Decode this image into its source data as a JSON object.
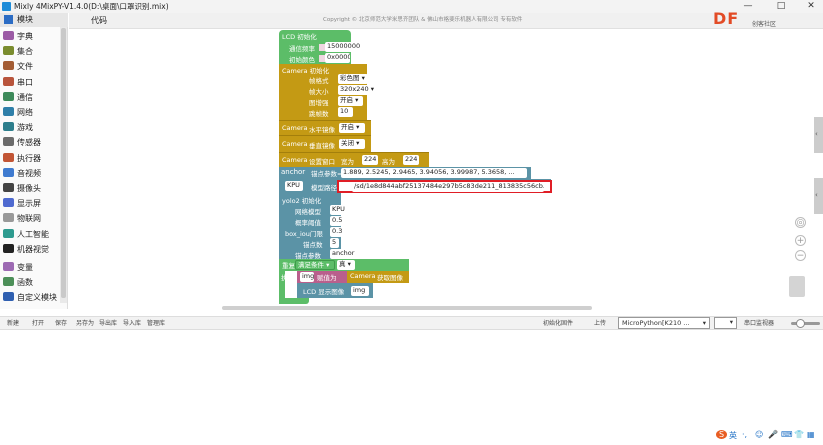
{
  "window": {
    "title": "Mixly 4MixPY-V1.4.0(D:\\桌面\\口罩识别.mix)",
    "controls": {
      "minimize": "—",
      "maximize": "□",
      "close": "✕"
    }
  },
  "sidebar": {
    "header": "模块",
    "items": [
      {
        "label": "字典",
        "color": "#9b5ba5"
      },
      {
        "label": "集合",
        "color": "#7a8c2e"
      },
      {
        "label": "文件",
        "color": "#a35c34"
      },
      {
        "label": "串口",
        "color": "#b8543c"
      },
      {
        "label": "通信",
        "color": "#3d8a5a"
      },
      {
        "label": "网络",
        "color": "#2f7fa9"
      },
      {
        "label": "游戏",
        "color": "#2d7e8c"
      },
      {
        "label": "传感器",
        "color": "#6b6b6b"
      },
      {
        "label": "执行器",
        "color": "#c25535"
      },
      {
        "label": "音视频",
        "color": "#3f7bd0"
      },
      {
        "label": "摄像头",
        "color": "#444444"
      },
      {
        "label": "显示屏",
        "color": "#4f6ad0"
      },
      {
        "label": "物联网",
        "color": "#999999"
      },
      {
        "label": "人工智能",
        "color": "#2e9b8f"
      },
      {
        "label": "机器视觉",
        "color": "#222222"
      },
      {
        "label": "变量",
        "color": "#9d6ab3"
      },
      {
        "label": "函数",
        "color": "#4c8f58"
      },
      {
        "label": "自定义模块",
        "color": "#2f5fb0"
      }
    ]
  },
  "tabs": {
    "code": "代码"
  },
  "copyright": "Copyright © 北京师范大学米思齐团队 & 佛山市格斐乐机器人有限公司 专有软件",
  "brand": {
    "logo": "DF",
    "sub": "创客社区"
  },
  "blocks": {
    "lcd_init": {
      "title": "LCD 初始化",
      "freq_label": "通信频率",
      "freq": "15000000",
      "color_label": "初始颜色",
      "color": "0x0000"
    },
    "camera_init": {
      "title": "Camera 初始化",
      "format_label": "帧格式",
      "format": "彩色图",
      "size_label": "帧大小",
      "size": "320x240",
      "flip_label": "图增强",
      "flip": "开启",
      "skip_label": "跳帧数",
      "skip": "10"
    },
    "hmirror": {
      "prefix": "Camera",
      "label": "水平镜像",
      "value": "开启"
    },
    "vflip": {
      "prefix": "Camera",
      "label": "垂直镜像",
      "value": "关闭"
    },
    "window": {
      "prefix": "Camera",
      "label": "设置窗口",
      "w_label": "宽为",
      "w": "224",
      "h_label": "高为",
      "h": "224"
    },
    "anchor": {
      "name": "anchor",
      "label": "锚点参数=",
      "value": "1.889, 2.5245, 2.9465, 3.94056, 3.99987, 5.3658, ..."
    },
    "kpu": {
      "name": "KPU",
      "label": "模型路径",
      "path": "/sd/1e8d844abf25137484e297b5c83de211_813835c56cb..."
    },
    "yolo": {
      "title": "yolo2 初始化",
      "net_label": "网络模型",
      "net": "KPU",
      "prob_label": "概率阈值",
      "prob": "0.5",
      "iou_label": "box_iou门限",
      "iou": "0.3",
      "anc_num_label": "锚点数",
      "anc_num": "5",
      "anc_label": "锚点参数",
      "anc": "anchor"
    },
    "loop": {
      "label": "重复",
      "mode": "满足条件",
      "cond": "真",
      "do_label": "执行",
      "var": "img",
      "assign": "赋值为",
      "cam": "Camera",
      "snap": "获取图像",
      "lcd": "LCD 显示图像",
      "img": "img"
    }
  },
  "toolbar": {
    "left": [
      "新建",
      "打开",
      "保存",
      "另存为",
      "导出库",
      "导入库",
      "管理库"
    ],
    "init_fw": "初始化固件",
    "upload": "上传",
    "device": "MicroPython[K210 ...",
    "serial": "串口监视器"
  },
  "ime": {
    "icons": [
      "S",
      "英",
      "·,",
      "☺",
      "🎤",
      "⌨",
      "👕",
      "▦"
    ]
  }
}
